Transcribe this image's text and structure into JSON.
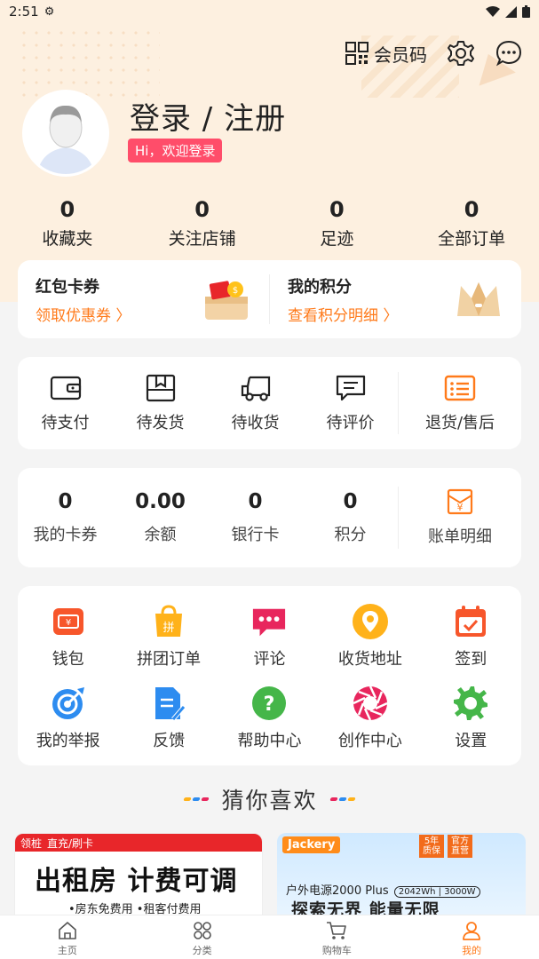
{
  "status_bar": {
    "time": "2:51"
  },
  "header": {
    "member_code_label": "会员码"
  },
  "profile": {
    "title": "登录 / 注册",
    "welcome": "Hi，欢迎登录"
  },
  "stats": [
    {
      "value": "0",
      "label": "收藏夹"
    },
    {
      "value": "0",
      "label": "关注店铺"
    },
    {
      "value": "0",
      "label": "足迹"
    },
    {
      "value": "0",
      "label": "全部订单"
    }
  ],
  "coupons": {
    "left": {
      "title": "红包卡券",
      "link": "领取优惠券 〉"
    },
    "right": {
      "title": "我的积分",
      "link": "查看积分明细 〉"
    }
  },
  "orders": [
    {
      "label": "待支付",
      "icon": "wallet-icon"
    },
    {
      "label": "待发货",
      "icon": "package-icon"
    },
    {
      "label": "待收货",
      "icon": "truck-icon"
    },
    {
      "label": "待评价",
      "icon": "comment-icon"
    },
    {
      "label": "退货/售后",
      "icon": "refund-list-icon"
    }
  ],
  "wallet": [
    {
      "value": "0",
      "label": "我的卡券"
    },
    {
      "value": "0.00",
      "label": "余额"
    },
    {
      "value": "0",
      "label": "银行卡"
    },
    {
      "value": "0",
      "label": "积分"
    }
  ],
  "bill_detail_label": "账单明细",
  "tools": [
    {
      "label": "钱包",
      "icon": "wallet-icon",
      "color": "#f7562b"
    },
    {
      "label": "拼团订单",
      "icon": "group-buy-icon",
      "color": "#ffb21a"
    },
    {
      "label": "评论",
      "icon": "comment-icon",
      "color": "#e8265d"
    },
    {
      "label": "收货地址",
      "icon": "location-icon",
      "color": "#ffb21a"
    },
    {
      "label": "签到",
      "icon": "calendar-check-icon",
      "color": "#f7562b"
    },
    {
      "label": "我的举报",
      "icon": "target-icon",
      "color": "#2d8cf0"
    },
    {
      "label": "反馈",
      "icon": "feedback-doc-icon",
      "color": "#2d8cf0"
    },
    {
      "label": "帮助中心",
      "icon": "help-icon",
      "color": "#45b649"
    },
    {
      "label": "创作中心",
      "icon": "aperture-icon",
      "color": "#e8265d"
    },
    {
      "label": "设置",
      "icon": "gear-icon",
      "color": "#45b649"
    }
  ],
  "guess_title": "猜你喜欢",
  "products": [
    {
      "tag1": "领桩",
      "tag2": "直充/刷卡",
      "headline": "出租房 计费可调",
      "sub": "•房东免费用 •租客付费用"
    },
    {
      "brand": "Jackery",
      "badge1": "5年 质保",
      "badge2": "官方 直营",
      "line1": "户外电源2000 Plus",
      "spec": "2042Wh | 3000W",
      "line2": "探索无界  能量无限"
    }
  ],
  "bottom_nav": [
    {
      "label": "主页",
      "icon": "home-icon"
    },
    {
      "label": "分类",
      "icon": "category-icon"
    },
    {
      "label": "购物车",
      "icon": "cart-icon"
    },
    {
      "label": "我的",
      "icon": "profile-icon"
    }
  ]
}
